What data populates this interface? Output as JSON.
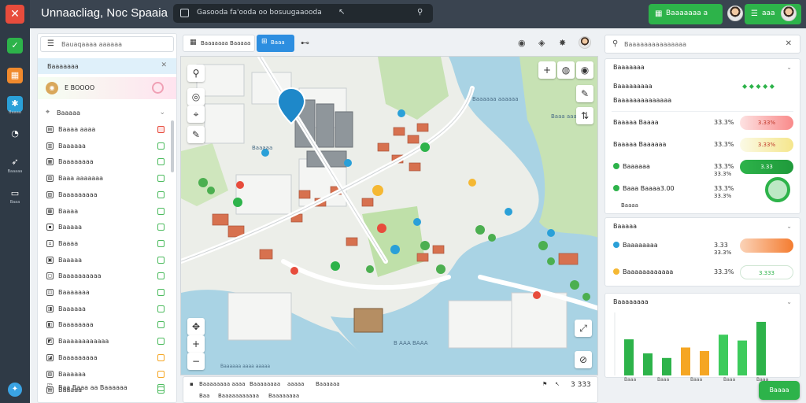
{
  "app": {
    "title": "Unnaacliag, Noc Spaaia"
  },
  "search": {
    "text": "Gasooda fa'ooda oo bosuugaaooda"
  },
  "header_buttons": {
    "primary": "Baaaaaaa a",
    "secondary": "aaa"
  },
  "rail": {
    "items": [
      {
        "icon": "shield-check-icon",
        "label": ""
      },
      {
        "icon": "calendar-icon",
        "label": ""
      },
      {
        "icon": "settings-cog-icon",
        "label": "Baaaa"
      },
      {
        "icon": "dashboard-icon",
        "label": "Baaa"
      },
      {
        "icon": "rocket-icon",
        "label": "Baaaaa"
      },
      {
        "icon": "monitor-icon",
        "label": "Baaa"
      }
    ]
  },
  "left_panel": {
    "search": "Bauaqaaaa aaaaaa",
    "section_title": "Baaaaaaa",
    "selected": "E BOOOO",
    "list_header": "Baaaaa",
    "items": [
      "Baaaa aaaa",
      "Baaaaaa",
      "Baaaaaaaa",
      "Baaa aaaaaaa",
      "Baaaaaaaaa",
      "Baaaa",
      "Baaaaa",
      "Baaaa",
      "Baaaaa",
      "Baaaaaaaaaa",
      "Baaaaaaa",
      "Baaaaaa",
      "Baaaaaaaa",
      "Baaaaaaaaaaaa",
      "Baaaaaaaaa",
      "Baaaaaa",
      "Baaaaa"
    ],
    "footer": "Baa Baaa aa Baaaaaa"
  },
  "map_toolbar": {
    "field": "Baaaaaaa Baaaaa",
    "active": "Baaa"
  },
  "map": {
    "labels": [
      "Baaaaaa aaaaaa",
      "Baaa aaaaa",
      "Baaaaa",
      "B AAA BAAA",
      "Baaaaaa aaaa aaaaa",
      "Baaaaaa aaaaa aaaaa"
    ]
  },
  "map_footer": {
    "items": [
      "Baaaaaaaa aaaa",
      "Baaaaaaaa",
      "aaaaa",
      "Baaaaaa"
    ],
    "items2": [
      "Baa",
      "Baaaaaaaaaaa",
      "Baaaaaaaa"
    ],
    "stat": "3 333"
  },
  "right_panel": {
    "search": "Baaaaaaaaaaaaaaa",
    "card1": {
      "title": "Baaaaaaa",
      "subtitle": "Baaaaaaaaa",
      "subtitle2": "Baaaaaaaaaaaaaa",
      "rows": [
        {
          "label": "Baaaaa Baaaa",
          "value": "33.3%",
          "pill": "3.33%",
          "color": "#f16f6f"
        },
        {
          "label": "Baaaaa Baaaaaa",
          "value": "33.3%",
          "pill": "3.33%",
          "color": "#f5e68c"
        },
        {
          "label": "Baaaaaa",
          "value": "33.3%",
          "sub": "33.3%",
          "pill": "3.33",
          "color": "#2db34a"
        },
        {
          "label": "Baaa Baaaa3.00",
          "value": "33.3%",
          "sub": "33.3%",
          "pill": "",
          "color": "#2db34a"
        }
      ],
      "subrow": "Baaaa"
    },
    "card2": {
      "title": "Baaaaa",
      "rows": [
        {
          "label": "Baaaaaaaa",
          "value": "3.33",
          "sub": "33.3%",
          "color": "#2aa0d8",
          "pill": ""
        },
        {
          "label": "Baaaaaaaaaaaa",
          "value": "33.3%",
          "pill": "3.333",
          "color": "#f5b833"
        }
      ]
    },
    "card3": {
      "title": "Baaaaaaaa",
      "categories": [
        "Baaa",
        "Baaa",
        "Baaa",
        "Baaa",
        "Baaa"
      ]
    },
    "fab": "Baaaa"
  },
  "colors": {
    "accent": "#2d8ee0",
    "brand_green": "#2db34a",
    "header": "#3a4450",
    "rail": "#2f3a46"
  }
}
